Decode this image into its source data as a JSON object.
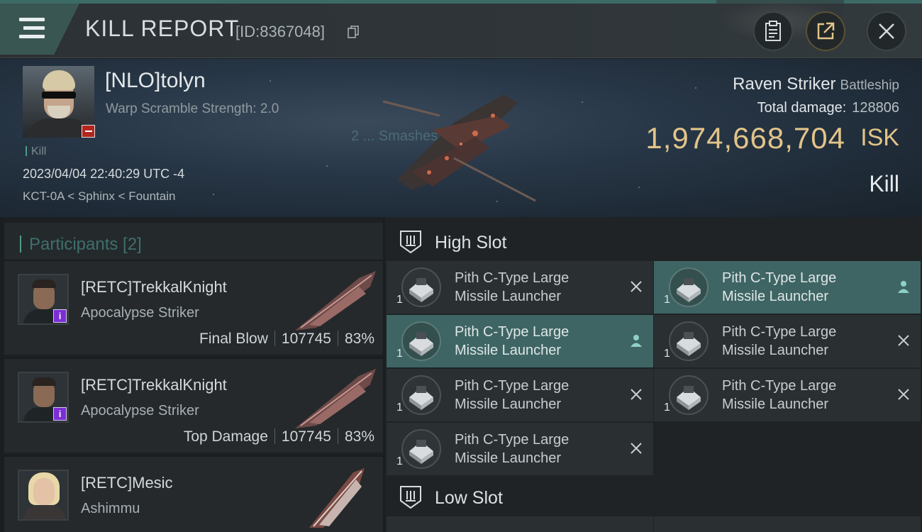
{
  "header": {
    "title": "KILL REPORT",
    "report_id": "[ID:8367048]"
  },
  "victim": {
    "name": "[NLO]tolyn",
    "warp_scramble": "Warp Scramble Strength: 2.0",
    "kill_tag": "Kill",
    "datetime": "2023/04/04 22:40:29 UTC -4",
    "location": "KCT-0A < Sphinx < Fountain",
    "ship_name": "Raven Striker",
    "ship_class": "Battleship",
    "total_damage_label": "Total damage:",
    "total_damage": "128806",
    "isk_value": "1,974,668,704",
    "isk_unit": "ISK",
    "result": "Kill",
    "ghost_text": "2 ... Smashes"
  },
  "participants": {
    "label": "Participants [2]",
    "rows": [
      {
        "name": "[RETC]TrekkalKnight",
        "ship": "Apocalypse Striker",
        "role": "Final Blow",
        "damage": "107745",
        "percent": "83%",
        "badge": "i"
      },
      {
        "name": "[RETC]TrekkalKnight",
        "ship": "Apocalypse Striker",
        "role": "Top Damage",
        "damage": "107745",
        "percent": "83%",
        "badge": "i"
      },
      {
        "name": "[RETC]Mesic",
        "ship": "Ashimmu",
        "role": "",
        "damage": "",
        "percent": "",
        "badge": ""
      }
    ]
  },
  "fitting": {
    "high_slot_title": "High Slot",
    "low_slot_title": "Low Slot",
    "modules": [
      {
        "name_line1": "Pith C-Type Large",
        "name_line2": "Missile Launcher",
        "qty": "1",
        "status": "destroyed"
      },
      {
        "name_line1": "Pith C-Type Large",
        "name_line2": "Missile Launcher",
        "qty": "1",
        "status": "dropped"
      },
      {
        "name_line1": "Pith C-Type Large",
        "name_line2": "Missile Launcher",
        "qty": "1",
        "status": "dropped"
      },
      {
        "name_line1": "Pith C-Type Large",
        "name_line2": "Missile Launcher",
        "qty": "1",
        "status": "destroyed"
      },
      {
        "name_line1": "Pith C-Type Large",
        "name_line2": "Missile Launcher",
        "qty": "1",
        "status": "destroyed"
      },
      {
        "name_line1": "Pith C-Type Large",
        "name_line2": "Missile Launcher",
        "qty": "1",
        "status": "destroyed"
      },
      {
        "name_line1": "Pith C-Type Large",
        "name_line2": "Missile Launcher",
        "qty": "1",
        "status": "destroyed"
      }
    ]
  },
  "colors": {
    "accent_teal": "#3e6563",
    "isk_gold": "#e2c489",
    "loss_red": "#b3261e",
    "corp_purple": "#7b2ed6"
  },
  "icons": {
    "menu": "hamburger-menu-icon",
    "copy": "copy-icon",
    "clipboard": "clipboard-icon",
    "share": "share-icon",
    "close": "close-icon",
    "slot": "slot-icon",
    "destroyed": "x-icon",
    "dropped": "person-icon"
  }
}
